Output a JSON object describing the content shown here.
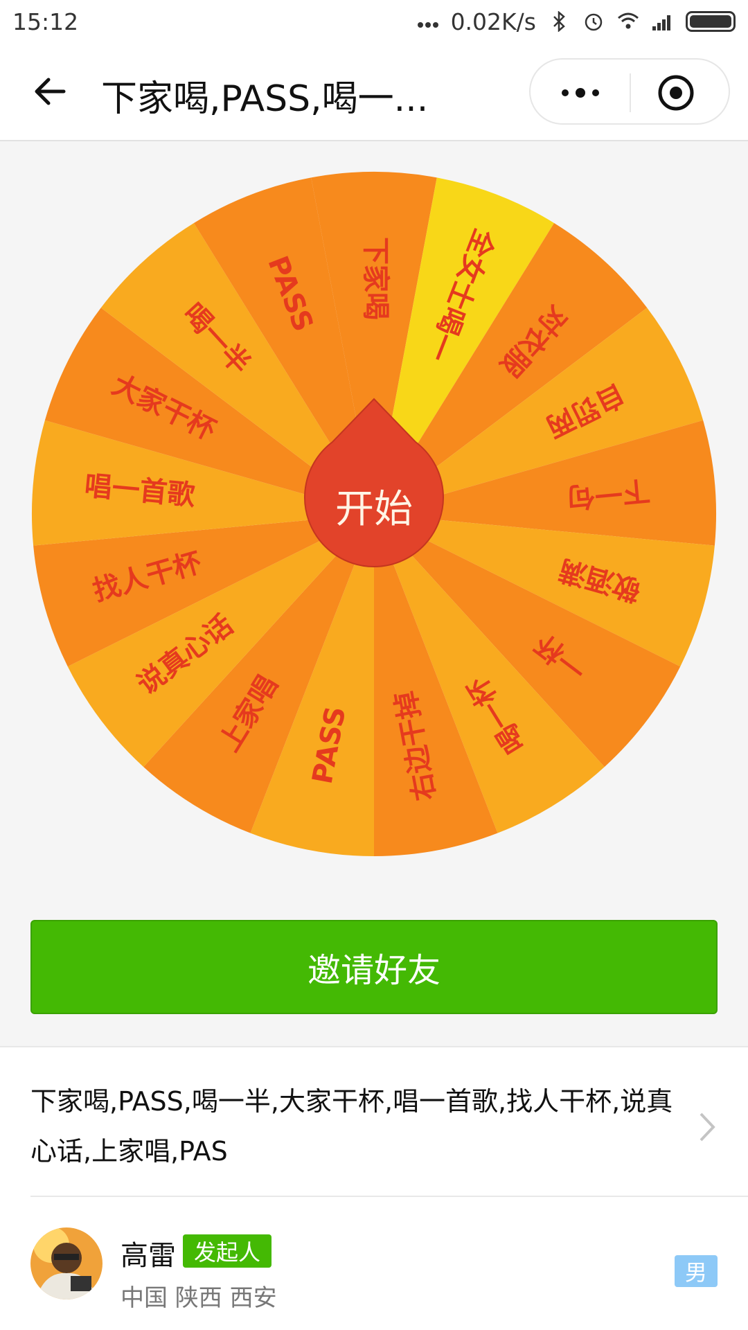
{
  "status_bar": {
    "time": "15:12",
    "network_speed": "0.02K/s",
    "icons": [
      "dots-icon",
      "bluetooth-icon",
      "alarm-icon",
      "wifi-icon",
      "signal-icon",
      "battery-icon"
    ]
  },
  "nav": {
    "title": "下家喝,PASS,喝一...",
    "back_icon": "back-arrow-icon",
    "more_icon": "more-dots-icon",
    "close_icon": "target-icon"
  },
  "wheel": {
    "segments": [
      "下家喝",
      "全女士喝一",
      "对衣服",
      "自罚两",
      "下一句",
      "敬酒满",
      "一杯",
      "喝一杯",
      "右边干掉",
      "PASS",
      "上家唱",
      "说真心话",
      "找人干杯",
      "唱一首歌",
      "大家干杯",
      "喝一半",
      "PASS"
    ],
    "center_label": "开始",
    "colors": {
      "light": "#f9aa1f",
      "dark": "#f78a1d",
      "highlight": "#f8d718",
      "pointer": "#e2432a",
      "label": "#e53a1e"
    }
  },
  "invite": {
    "label": "邀请好友",
    "color": "#44b904"
  },
  "options": {
    "text": "下家喝,PASS,喝一半,大家干杯,唱一首歌,找人干杯,说真心话,上家唱,PAS"
  },
  "user": {
    "name": "高雷",
    "role_badge": "发起人",
    "location": "中国 陕西 西安",
    "gender": "男"
  }
}
